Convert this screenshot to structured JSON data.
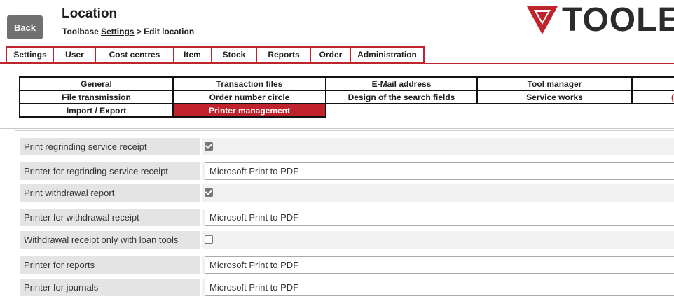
{
  "header": {
    "back_label": "Back",
    "title": "Location",
    "breadcrumb_prefix": "Toolbase ",
    "breadcrumb_link": "Settings",
    "breadcrumb_suffix": " > Edit location",
    "logo_text": "TOOLE"
  },
  "main_nav": {
    "items": [
      {
        "label": "Settings"
      },
      {
        "label": "User"
      },
      {
        "label": "Cost centres"
      },
      {
        "label": "Item"
      },
      {
        "label": "Stock"
      },
      {
        "label": "Reports"
      },
      {
        "label": "Order"
      },
      {
        "label": "Administration"
      }
    ]
  },
  "sub_tabs": {
    "rows": [
      [
        "General",
        "Transaction files",
        "E-Mail address",
        "Tool manager"
      ],
      [
        "File transmission",
        "Order number circle",
        "Design of the search fields",
        "Service works"
      ],
      [
        "Import / Export",
        "Printer management"
      ]
    ],
    "active": "Printer management",
    "overflow_char": "("
  },
  "settings": {
    "rows": [
      {
        "label": "Print regrinding service receipt",
        "type": "checkbox",
        "checked": true
      },
      {
        "label": "Printer for regrinding service receipt",
        "type": "select",
        "value": "Microsoft Print to PDF"
      },
      {
        "label": "Print withdrawal report",
        "type": "checkbox",
        "checked": true
      },
      {
        "label": "Printer for withdrawal receipt",
        "type": "select",
        "value": "Microsoft Print to PDF"
      },
      {
        "label": "Withdrawal receipt only with loan tools",
        "type": "checkbox",
        "checked": false
      },
      {
        "label": "Printer for reports",
        "type": "select",
        "value": "Microsoft Print to PDF"
      },
      {
        "label": "Printer for journals",
        "type": "select",
        "value": "Microsoft Print to PDF"
      }
    ]
  },
  "colors": {
    "accent": "#c0232b",
    "back_button": "#707070"
  }
}
